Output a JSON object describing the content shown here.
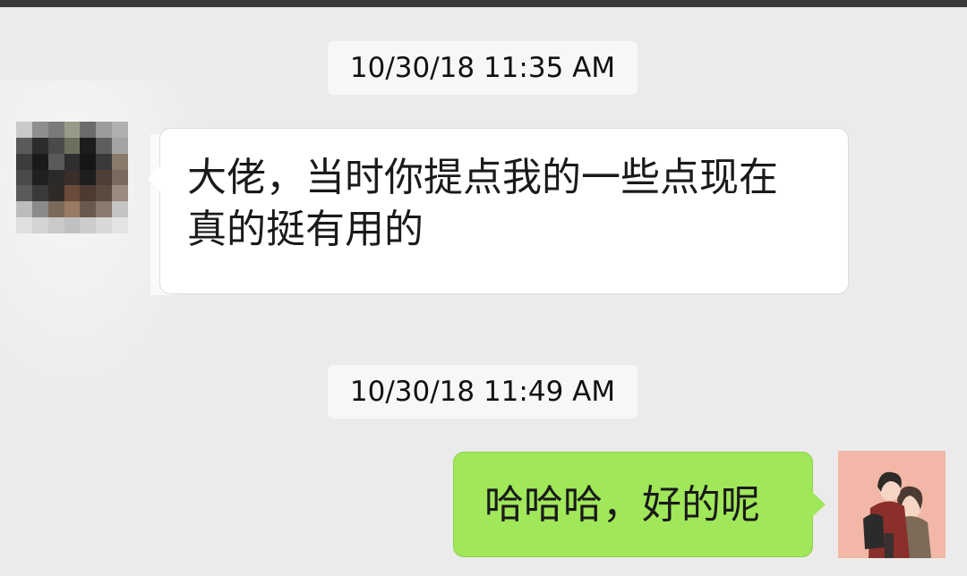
{
  "colors": {
    "background": "#ebebeb",
    "incoming_bubble": "#ffffff",
    "outgoing_bubble": "#a0e759",
    "timestamp_bg": "#f7f7f7"
  },
  "messages": [
    {
      "timestamp": "10/30/18 11:35 AM",
      "sender": "other",
      "avatar": "pixelated-avatar",
      "text_lines": [
        "大佬，当时你提点我的一些点现在",
        "真的挺有用的"
      ]
    },
    {
      "timestamp": "10/30/18 11:49 AM",
      "sender": "self",
      "avatar": "cartoon-couple-avatar",
      "text_lines": [
        "哈哈哈，好的呢"
      ]
    }
  ]
}
